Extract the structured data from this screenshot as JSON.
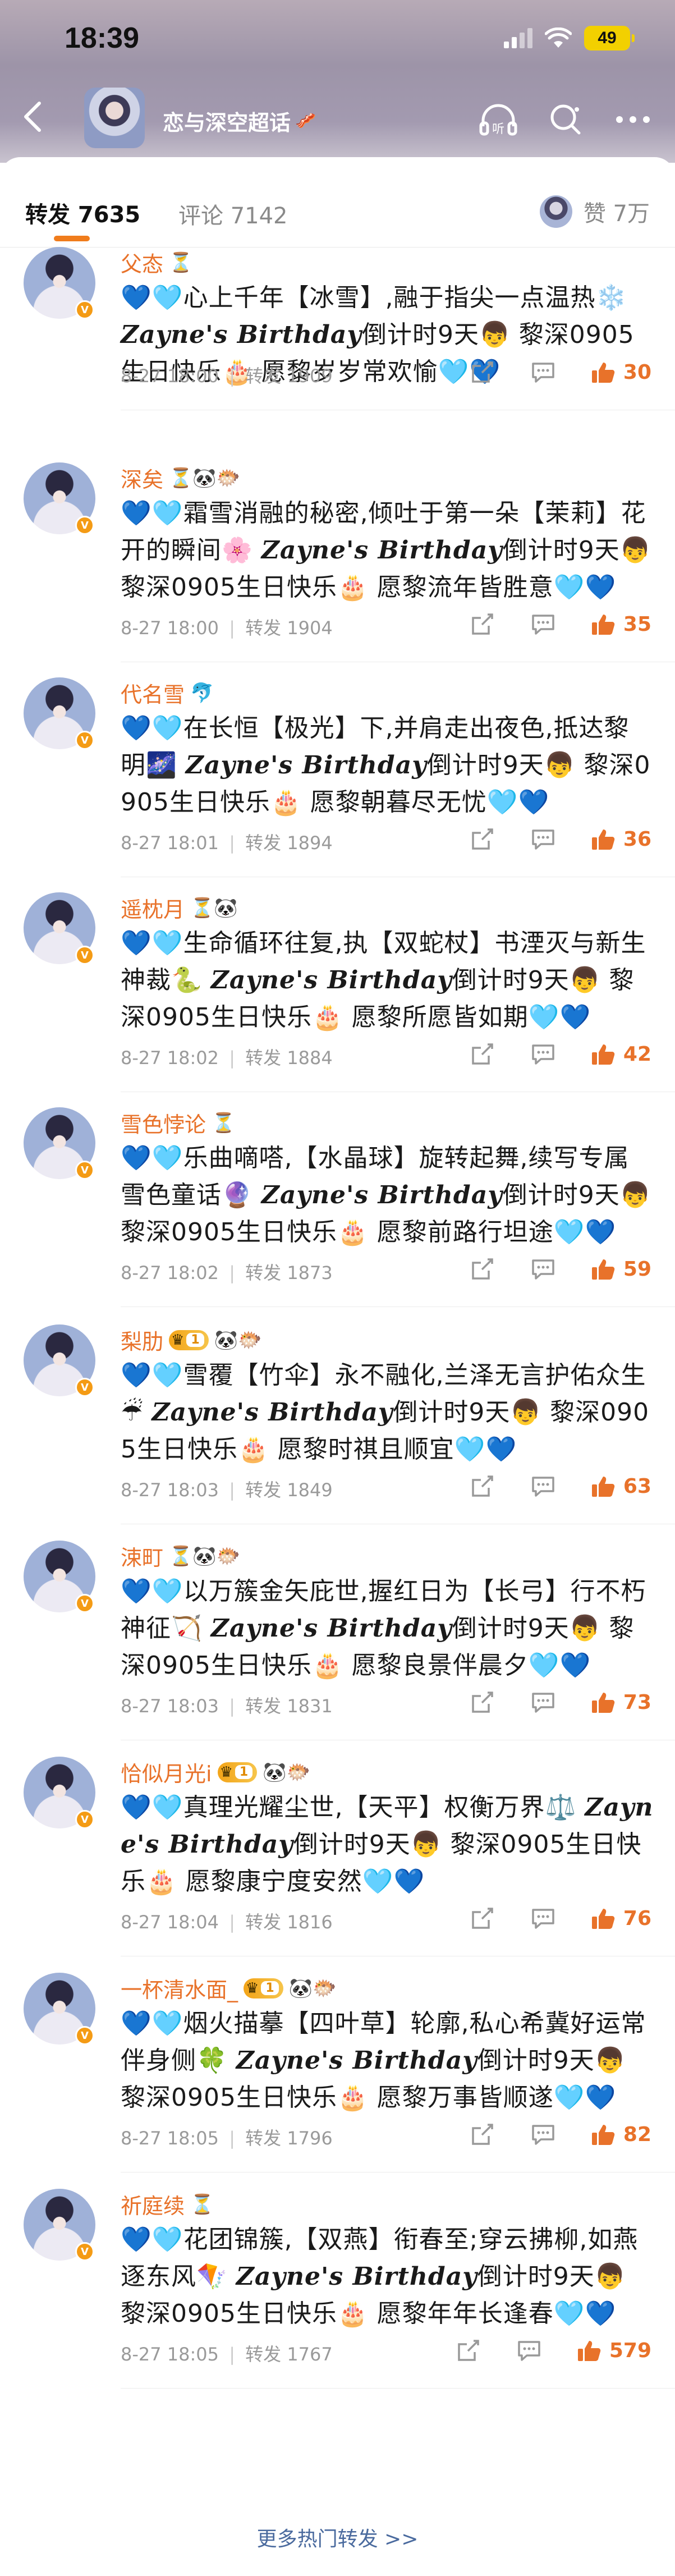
{
  "status": {
    "time": "18:39",
    "battery": "49"
  },
  "nav": {
    "title": "恋与深空超话",
    "title_emoji": "🥓",
    "listen": "听"
  },
  "tabs": {
    "repost": "转发 7635",
    "comment": "评论 7142",
    "like": "赞 7万"
  },
  "colors": {
    "accent": "#e8722a",
    "link": "#4a6a9e",
    "tab_underline": "#f07c1c"
  },
  "items": [
    {
      "name": "父态",
      "tags": "⏳",
      "level": null,
      "time": "8-27 18:00",
      "repost": "转发 1909",
      "likes": "30",
      "pre": "💙🩵心上千年【冰雪】,融于指尖一点温热❄️ ",
      "post": "倒计时9天👦 黎深0905生日快乐🎂 愿黎岁岁常欢愉🩵💙"
    },
    {
      "name": "深矣",
      "tags": "⏳🐼🐡",
      "level": null,
      "time": "8-27 18:00",
      "repost": "转发 1904",
      "likes": "35",
      "pre": "💙🩵霜雪消融的秘密,倾吐于第一朵【茉莉】花开的瞬间🌸 ",
      "post": "倒计时9天👦 黎深0905生日快乐🎂 愿黎流年皆胜意🩵💙"
    },
    {
      "name": "代名雪",
      "tags": "🐬",
      "level": null,
      "time": "8-27 18:01",
      "repost": "转发 1894",
      "likes": "36",
      "pre": "💙🩵在长恒【极光】下,并肩走出夜色,抵达黎明🌌 ",
      "post": "倒计时9天👦 黎深0905生日快乐🎂 愿黎朝暮尽无忧🩵💙"
    },
    {
      "name": "遥枕月",
      "tags": "⏳🐼",
      "level": null,
      "time": "8-27 18:02",
      "repost": "转发 1884",
      "likes": "42",
      "pre": "💙🩵生命循环往复,执【双蛇杖】书湮灭与新生神裁🐍 ",
      "post": "倒计时9天👦 黎深0905生日快乐🎂 愿黎所愿皆如期🩵💙"
    },
    {
      "name": "雪色悖论",
      "tags": "⏳",
      "level": null,
      "time": "8-27 18:02",
      "repost": "转发 1873",
      "likes": "59",
      "pre": "💙🩵乐曲嘀嗒,【水晶球】旋转起舞,续写专属雪色童话🔮 ",
      "post": "倒计时9天👦 黎深0905生日快乐🎂 愿黎前路行坦途🩵💙"
    },
    {
      "name": "梨肋",
      "tags": "🐼🐡",
      "level": "1",
      "time": "8-27 18:03",
      "repost": "转发 1849",
      "likes": "63",
      "pre": "💙🩵雪覆【竹伞】永不融化,兰泽无言护佑众生☔ ",
      "post": "倒计时9天👦 黎深0905生日快乐🎂 愿黎时祺且顺宜🩵💙"
    },
    {
      "name": "涑町",
      "tags": "⏳🐼🐡",
      "level": null,
      "time": "8-27 18:03",
      "repost": "转发 1831",
      "likes": "73",
      "pre": "💙🩵以万簇金矢庇世,握红日为【长弓】行不朽神征🏹 ",
      "post": "倒计时9天👦 黎深0905生日快乐🎂 愿黎良景伴晨夕🩵💙"
    },
    {
      "name": "恰似月光i",
      "tags": "🐼🐡",
      "level": "1",
      "time": "8-27 18:04",
      "repost": "转发 1816",
      "likes": "76",
      "pre": "💙🩵真理光耀尘世,【天平】权衡万界⚖️ ",
      "post": "倒计时9天👦 黎深0905生日快乐🎂 愿黎康宁度安然🩵💙"
    },
    {
      "name": "一杯清水面_",
      "tags": "🐼🐡",
      "level": "1",
      "time": "8-27 18:05",
      "repost": "转发 1796",
      "likes": "82",
      "pre": "💙🩵烟火描摹【四叶草】轮廓,私心希冀好运常伴身侧🍀 ",
      "post": "倒计时9天👦 黎深0905生日快乐🎂 愿黎万事皆顺遂🩵💙"
    },
    {
      "name": "祈庭续",
      "tags": "⏳",
      "level": null,
      "time": "8-27 18:05",
      "repost": "转发 1767",
      "likes": "579",
      "pre": "💙🩵花团锦簇,【双燕】衔春至;穿云拂柳,如燕逐东风🪁 ",
      "post": "倒计时9天👦 黎深0905生日快乐🎂 愿黎年年长逢春🩵💙"
    }
  ],
  "birthday_label": "Zayne's Birthday",
  "more": "更多热门转发 >>"
}
